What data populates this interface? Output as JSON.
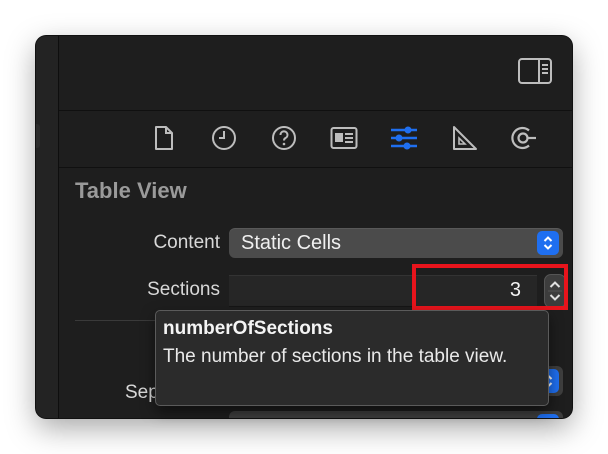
{
  "inspector": {
    "section_title": "Table View",
    "content": {
      "label": "Content",
      "value": "Static Cells"
    },
    "sections": {
      "label": "Sections",
      "value": "3"
    },
    "partial_label": "Sep"
  },
  "tabs": [
    {
      "name": "file-inspector-icon"
    },
    {
      "name": "history-inspector-icon"
    },
    {
      "name": "quick-help-icon"
    },
    {
      "name": "identity-inspector-icon"
    },
    {
      "name": "attributes-inspector-icon",
      "active": true
    },
    {
      "name": "size-inspector-icon"
    },
    {
      "name": "connections-inspector-icon"
    }
  ],
  "tooltip": {
    "title": "numberOfSections",
    "body": "The number of sections in the table view."
  },
  "colors": {
    "accent": "#1f6ff0",
    "highlight": "#e8141c",
    "panel": "#1e1e1e"
  }
}
